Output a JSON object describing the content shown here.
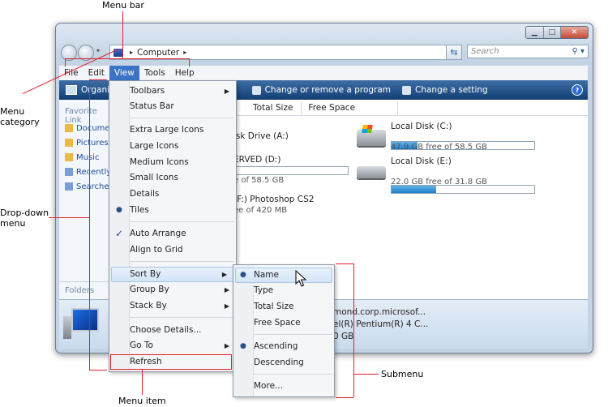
{
  "callouts": {
    "menu_bar": "Menu bar",
    "menu_category": [
      "Menu",
      "category"
    ],
    "dropdown_menu": [
      "Drop-down",
      "menu"
    ],
    "submenu": "Submenu",
    "menu_item": "Menu item"
  },
  "window": {
    "address": "Computer",
    "search_placeholder": "Search"
  },
  "menubar": [
    "File",
    "Edit",
    "View",
    "Tools",
    "Help"
  ],
  "active_menu": "View",
  "command_bar": {
    "organize": "Organiz",
    "change_program": "Change or remove a program",
    "change_setting": "Change a setting"
  },
  "left_pane": {
    "header": "Favorite Link",
    "links": [
      "Docume",
      "Pictures",
      "Music",
      "Recently",
      "Searche"
    ],
    "folders": "Folders"
  },
  "columns": [
    "Total Size",
    "Free Space"
  ],
  "drives": {
    "partial_a": "isk Drive (A:)",
    "partial_d_name": "ERVED (D:)",
    "partial_d_free": "e of 58.5 GB",
    "partial_f_name": "(F:) Photoshop CS2",
    "partial_f_free": "ee of 420 MB",
    "c_name": "Local Disk (C:)",
    "c_free": "47.9 GB free of 58.5 GB",
    "c_used_fraction": 0.18,
    "e_name": "Local Disk (E:)",
    "e_free": "22.0 GB free of 31.8 GB",
    "e_used_fraction": 0.31,
    "d_used_fraction": 0.0
  },
  "details_pane": {
    "line1": "mond.corp.microsof...",
    "line2": "el(R) Pentium(R) 4 C...",
    "line3": "0 GB"
  },
  "view_menu": {
    "toolbars": "Toolbars",
    "status_bar": "Status Bar",
    "extra_large_icons": "Extra Large Icons",
    "large_icons": "Large Icons",
    "medium_icons": "Medium Icons",
    "small_icons": "Small Icons",
    "details": "Details",
    "tiles": "Tiles",
    "auto_arrange": "Auto Arrange",
    "align_to_grid": "Align to Grid",
    "sort_by": "Sort By",
    "group_by": "Group By",
    "stack_by": "Stack By",
    "choose_details": "Choose Details...",
    "go_to": "Go To",
    "refresh": "Refresh"
  },
  "sort_submenu": {
    "name": "Name",
    "type": "Type",
    "total_size": "Total Size",
    "free_space": "Free Space",
    "ascending": "Ascending",
    "descending": "Descending",
    "more": "More..."
  }
}
